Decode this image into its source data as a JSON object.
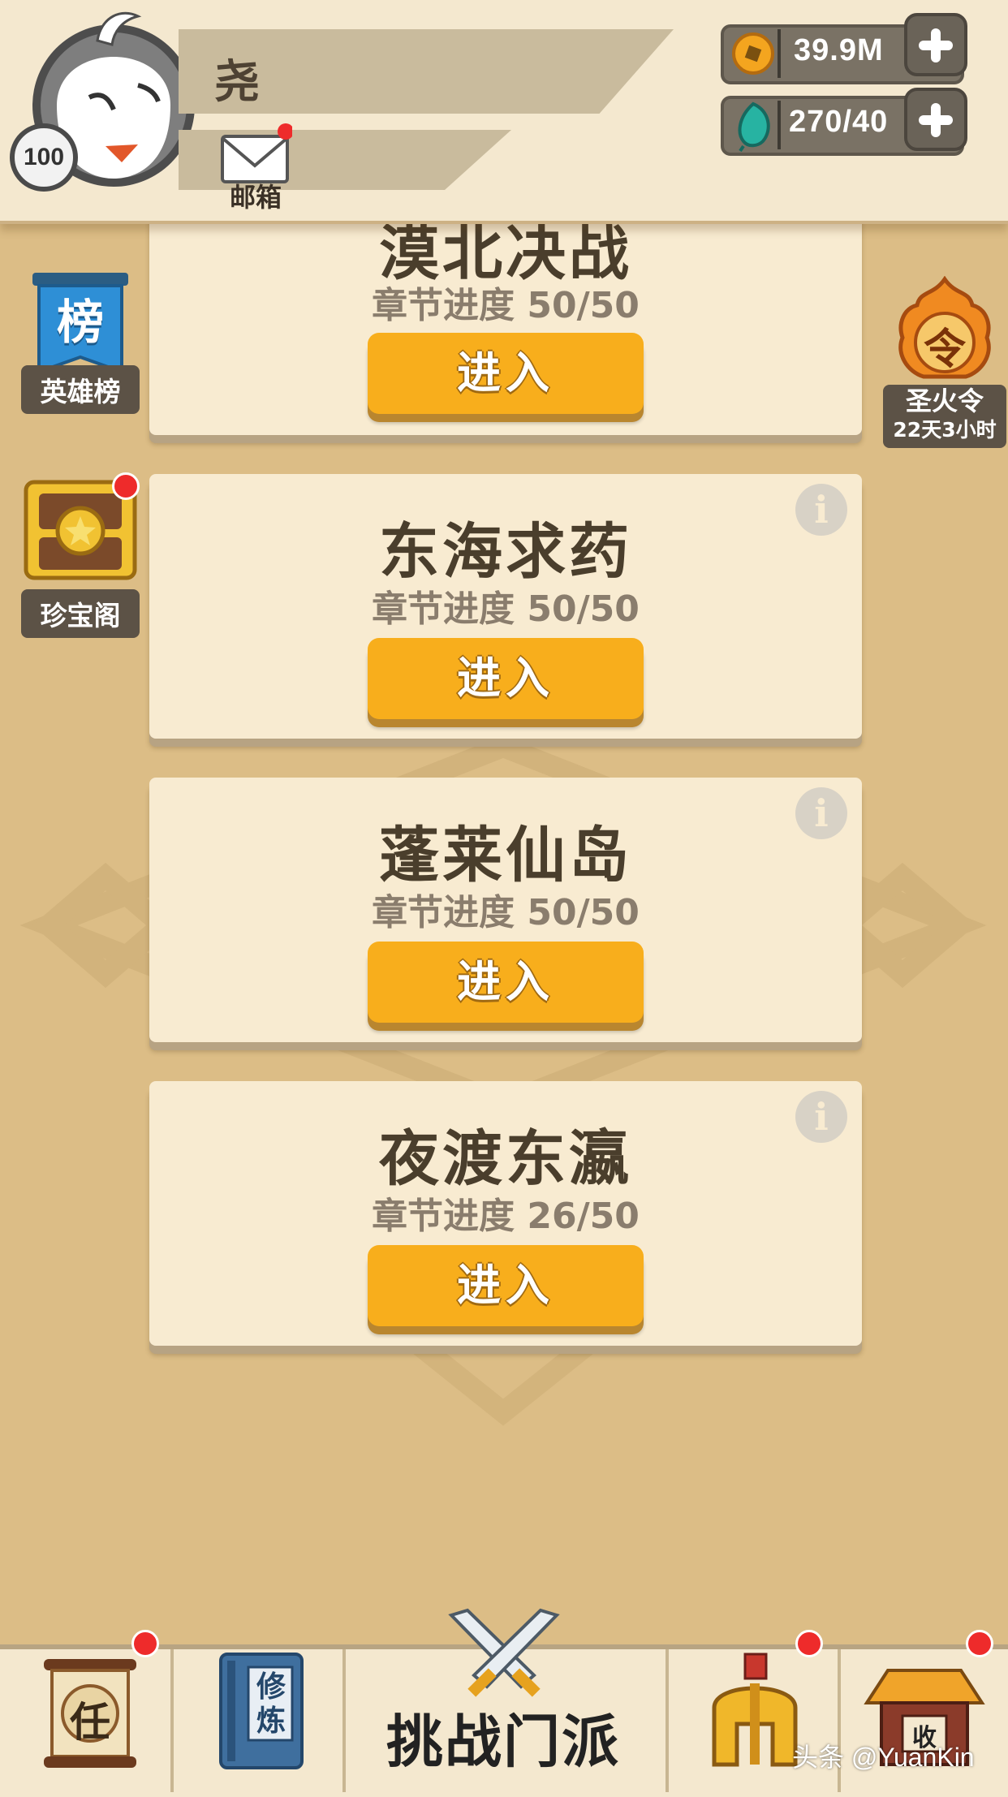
{
  "header": {
    "player_name": "尧",
    "level": "100",
    "mail_label": "邮箱",
    "coins": "39.9M",
    "energy": "270/40"
  },
  "side_left": [
    {
      "icon_char": "榜",
      "label": "英雄榜"
    },
    {
      "label": "珍宝阁"
    }
  ],
  "side_right": {
    "icon_char": "令",
    "label": "圣火令",
    "timer": "22天3小时"
  },
  "chapters": [
    {
      "title": "漠北决战",
      "progress": "章节进度 50/50",
      "button": "进入"
    },
    {
      "title": "东海求药",
      "progress": "章节进度 50/50",
      "button": "进入"
    },
    {
      "title": "蓬莱仙岛",
      "progress": "章节进度 50/50",
      "button": "进入"
    },
    {
      "title": "夜渡东瀛",
      "progress": "章节进度 26/50",
      "button": "进入"
    }
  ],
  "bottom_nav": {
    "task_char": "任",
    "training_book": "修炼",
    "challenge_label": "挑战门派",
    "collect_char": "收"
  },
  "watermark": "头条 @YuanKin",
  "colors": {
    "background": "#dcbd86",
    "card": "#f8ebd1",
    "button": "#f8ae1c",
    "notification": "#ee2b2b"
  }
}
